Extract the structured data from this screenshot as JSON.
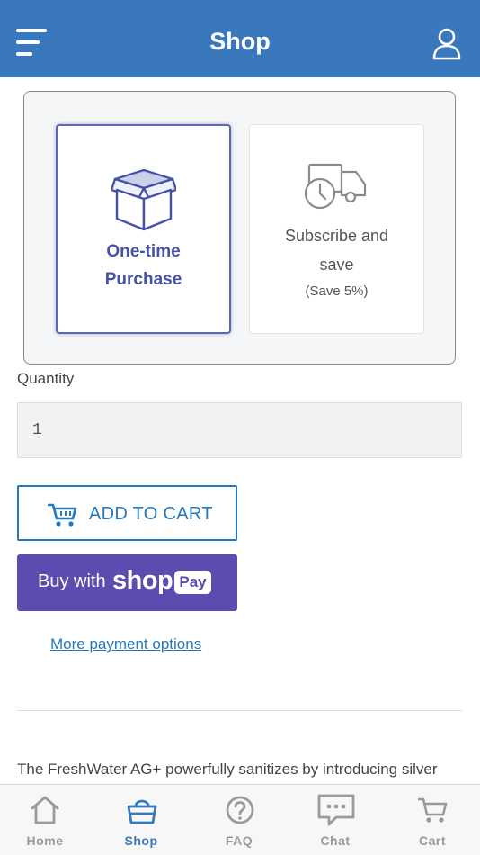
{
  "header": {
    "title": "Shop"
  },
  "purchase_options": {
    "one_time": {
      "line1": "One-time",
      "line2": "Purchase",
      "icon": "box-icon",
      "selected": true
    },
    "subscribe": {
      "line1": "Subscribe and",
      "line2": "save",
      "note": "(Save 5%)",
      "icon": "delivery-truck-icon",
      "selected": false
    }
  },
  "quantity": {
    "label": "Quantity",
    "value": "1"
  },
  "add_to_cart": {
    "label": "ADD TO CART",
    "icon": "cart-icon"
  },
  "shop_pay": {
    "prefix": "Buy with",
    "brand": "shop",
    "badge": "Pay"
  },
  "more_payment_options": "More payment options",
  "description": "The FreshWater AG+ powerfully sanitizes by introducing silver",
  "bottom_nav": {
    "items": [
      {
        "label": "Home",
        "icon": "home-icon",
        "active": false
      },
      {
        "label": "Shop",
        "icon": "shopping-basket-icon",
        "active": true
      },
      {
        "label": "FAQ",
        "icon": "question-icon",
        "active": false
      },
      {
        "label": "Chat",
        "icon": "chat-icon",
        "active": false
      },
      {
        "label": "Cart",
        "icon": "cart-icon",
        "active": false
      }
    ]
  },
  "colors": {
    "header_bg": "#3a78bd",
    "primary_blue": "#2479bd",
    "option_accent": "#4652a6",
    "shop_pay_bg": "#5b4db0",
    "nav_inactive": "#9a9a9a"
  }
}
